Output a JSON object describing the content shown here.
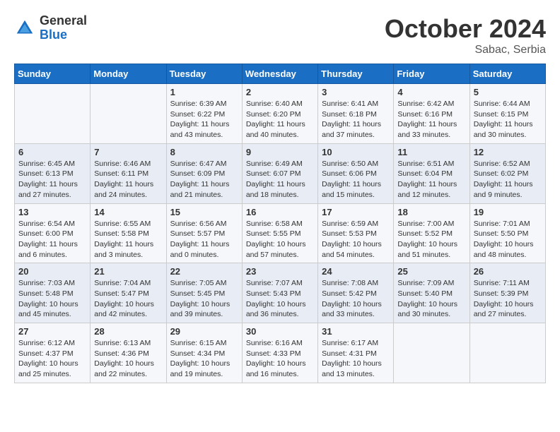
{
  "header": {
    "logo": {
      "general": "General",
      "blue": "Blue"
    },
    "title": "October 2024",
    "location": "Sabac, Serbia"
  },
  "weekdays": [
    "Sunday",
    "Monday",
    "Tuesday",
    "Wednesday",
    "Thursday",
    "Friday",
    "Saturday"
  ],
  "weeks": [
    [
      {
        "day": null,
        "content": null
      },
      {
        "day": null,
        "content": null
      },
      {
        "day": "1",
        "sunrise": "Sunrise: 6:39 AM",
        "sunset": "Sunset: 6:22 PM",
        "daylight": "Daylight: 11 hours and 43 minutes."
      },
      {
        "day": "2",
        "sunrise": "Sunrise: 6:40 AM",
        "sunset": "Sunset: 6:20 PM",
        "daylight": "Daylight: 11 hours and 40 minutes."
      },
      {
        "day": "3",
        "sunrise": "Sunrise: 6:41 AM",
        "sunset": "Sunset: 6:18 PM",
        "daylight": "Daylight: 11 hours and 37 minutes."
      },
      {
        "day": "4",
        "sunrise": "Sunrise: 6:42 AM",
        "sunset": "Sunset: 6:16 PM",
        "daylight": "Daylight: 11 hours and 33 minutes."
      },
      {
        "day": "5",
        "sunrise": "Sunrise: 6:44 AM",
        "sunset": "Sunset: 6:15 PM",
        "daylight": "Daylight: 11 hours and 30 minutes."
      }
    ],
    [
      {
        "day": "6",
        "sunrise": "Sunrise: 6:45 AM",
        "sunset": "Sunset: 6:13 PM",
        "daylight": "Daylight: 11 hours and 27 minutes."
      },
      {
        "day": "7",
        "sunrise": "Sunrise: 6:46 AM",
        "sunset": "Sunset: 6:11 PM",
        "daylight": "Daylight: 11 hours and 24 minutes."
      },
      {
        "day": "8",
        "sunrise": "Sunrise: 6:47 AM",
        "sunset": "Sunset: 6:09 PM",
        "daylight": "Daylight: 11 hours and 21 minutes."
      },
      {
        "day": "9",
        "sunrise": "Sunrise: 6:49 AM",
        "sunset": "Sunset: 6:07 PM",
        "daylight": "Daylight: 11 hours and 18 minutes."
      },
      {
        "day": "10",
        "sunrise": "Sunrise: 6:50 AM",
        "sunset": "Sunset: 6:06 PM",
        "daylight": "Daylight: 11 hours and 15 minutes."
      },
      {
        "day": "11",
        "sunrise": "Sunrise: 6:51 AM",
        "sunset": "Sunset: 6:04 PM",
        "daylight": "Daylight: 11 hours and 12 minutes."
      },
      {
        "day": "12",
        "sunrise": "Sunrise: 6:52 AM",
        "sunset": "Sunset: 6:02 PM",
        "daylight": "Daylight: 11 hours and 9 minutes."
      }
    ],
    [
      {
        "day": "13",
        "sunrise": "Sunrise: 6:54 AM",
        "sunset": "Sunset: 6:00 PM",
        "daylight": "Daylight: 11 hours and 6 minutes."
      },
      {
        "day": "14",
        "sunrise": "Sunrise: 6:55 AM",
        "sunset": "Sunset: 5:58 PM",
        "daylight": "Daylight: 11 hours and 3 minutes."
      },
      {
        "day": "15",
        "sunrise": "Sunrise: 6:56 AM",
        "sunset": "Sunset: 5:57 PM",
        "daylight": "Daylight: 11 hours and 0 minutes."
      },
      {
        "day": "16",
        "sunrise": "Sunrise: 6:58 AM",
        "sunset": "Sunset: 5:55 PM",
        "daylight": "Daylight: 10 hours and 57 minutes."
      },
      {
        "day": "17",
        "sunrise": "Sunrise: 6:59 AM",
        "sunset": "Sunset: 5:53 PM",
        "daylight": "Daylight: 10 hours and 54 minutes."
      },
      {
        "day": "18",
        "sunrise": "Sunrise: 7:00 AM",
        "sunset": "Sunset: 5:52 PM",
        "daylight": "Daylight: 10 hours and 51 minutes."
      },
      {
        "day": "19",
        "sunrise": "Sunrise: 7:01 AM",
        "sunset": "Sunset: 5:50 PM",
        "daylight": "Daylight: 10 hours and 48 minutes."
      }
    ],
    [
      {
        "day": "20",
        "sunrise": "Sunrise: 7:03 AM",
        "sunset": "Sunset: 5:48 PM",
        "daylight": "Daylight: 10 hours and 45 minutes."
      },
      {
        "day": "21",
        "sunrise": "Sunrise: 7:04 AM",
        "sunset": "Sunset: 5:47 PM",
        "daylight": "Daylight: 10 hours and 42 minutes."
      },
      {
        "day": "22",
        "sunrise": "Sunrise: 7:05 AM",
        "sunset": "Sunset: 5:45 PM",
        "daylight": "Daylight: 10 hours and 39 minutes."
      },
      {
        "day": "23",
        "sunrise": "Sunrise: 7:07 AM",
        "sunset": "Sunset: 5:43 PM",
        "daylight": "Daylight: 10 hours and 36 minutes."
      },
      {
        "day": "24",
        "sunrise": "Sunrise: 7:08 AM",
        "sunset": "Sunset: 5:42 PM",
        "daylight": "Daylight: 10 hours and 33 minutes."
      },
      {
        "day": "25",
        "sunrise": "Sunrise: 7:09 AM",
        "sunset": "Sunset: 5:40 PM",
        "daylight": "Daylight: 10 hours and 30 minutes."
      },
      {
        "day": "26",
        "sunrise": "Sunrise: 7:11 AM",
        "sunset": "Sunset: 5:39 PM",
        "daylight": "Daylight: 10 hours and 27 minutes."
      }
    ],
    [
      {
        "day": "27",
        "sunrise": "Sunrise: 6:12 AM",
        "sunset": "Sunset: 4:37 PM",
        "daylight": "Daylight: 10 hours and 25 minutes."
      },
      {
        "day": "28",
        "sunrise": "Sunrise: 6:13 AM",
        "sunset": "Sunset: 4:36 PM",
        "daylight": "Daylight: 10 hours and 22 minutes."
      },
      {
        "day": "29",
        "sunrise": "Sunrise: 6:15 AM",
        "sunset": "Sunset: 4:34 PM",
        "daylight": "Daylight: 10 hours and 19 minutes."
      },
      {
        "day": "30",
        "sunrise": "Sunrise: 6:16 AM",
        "sunset": "Sunset: 4:33 PM",
        "daylight": "Daylight: 10 hours and 16 minutes."
      },
      {
        "day": "31",
        "sunrise": "Sunrise: 6:17 AM",
        "sunset": "Sunset: 4:31 PM",
        "daylight": "Daylight: 10 hours and 13 minutes."
      },
      {
        "day": null,
        "content": null
      },
      {
        "day": null,
        "content": null
      }
    ]
  ]
}
